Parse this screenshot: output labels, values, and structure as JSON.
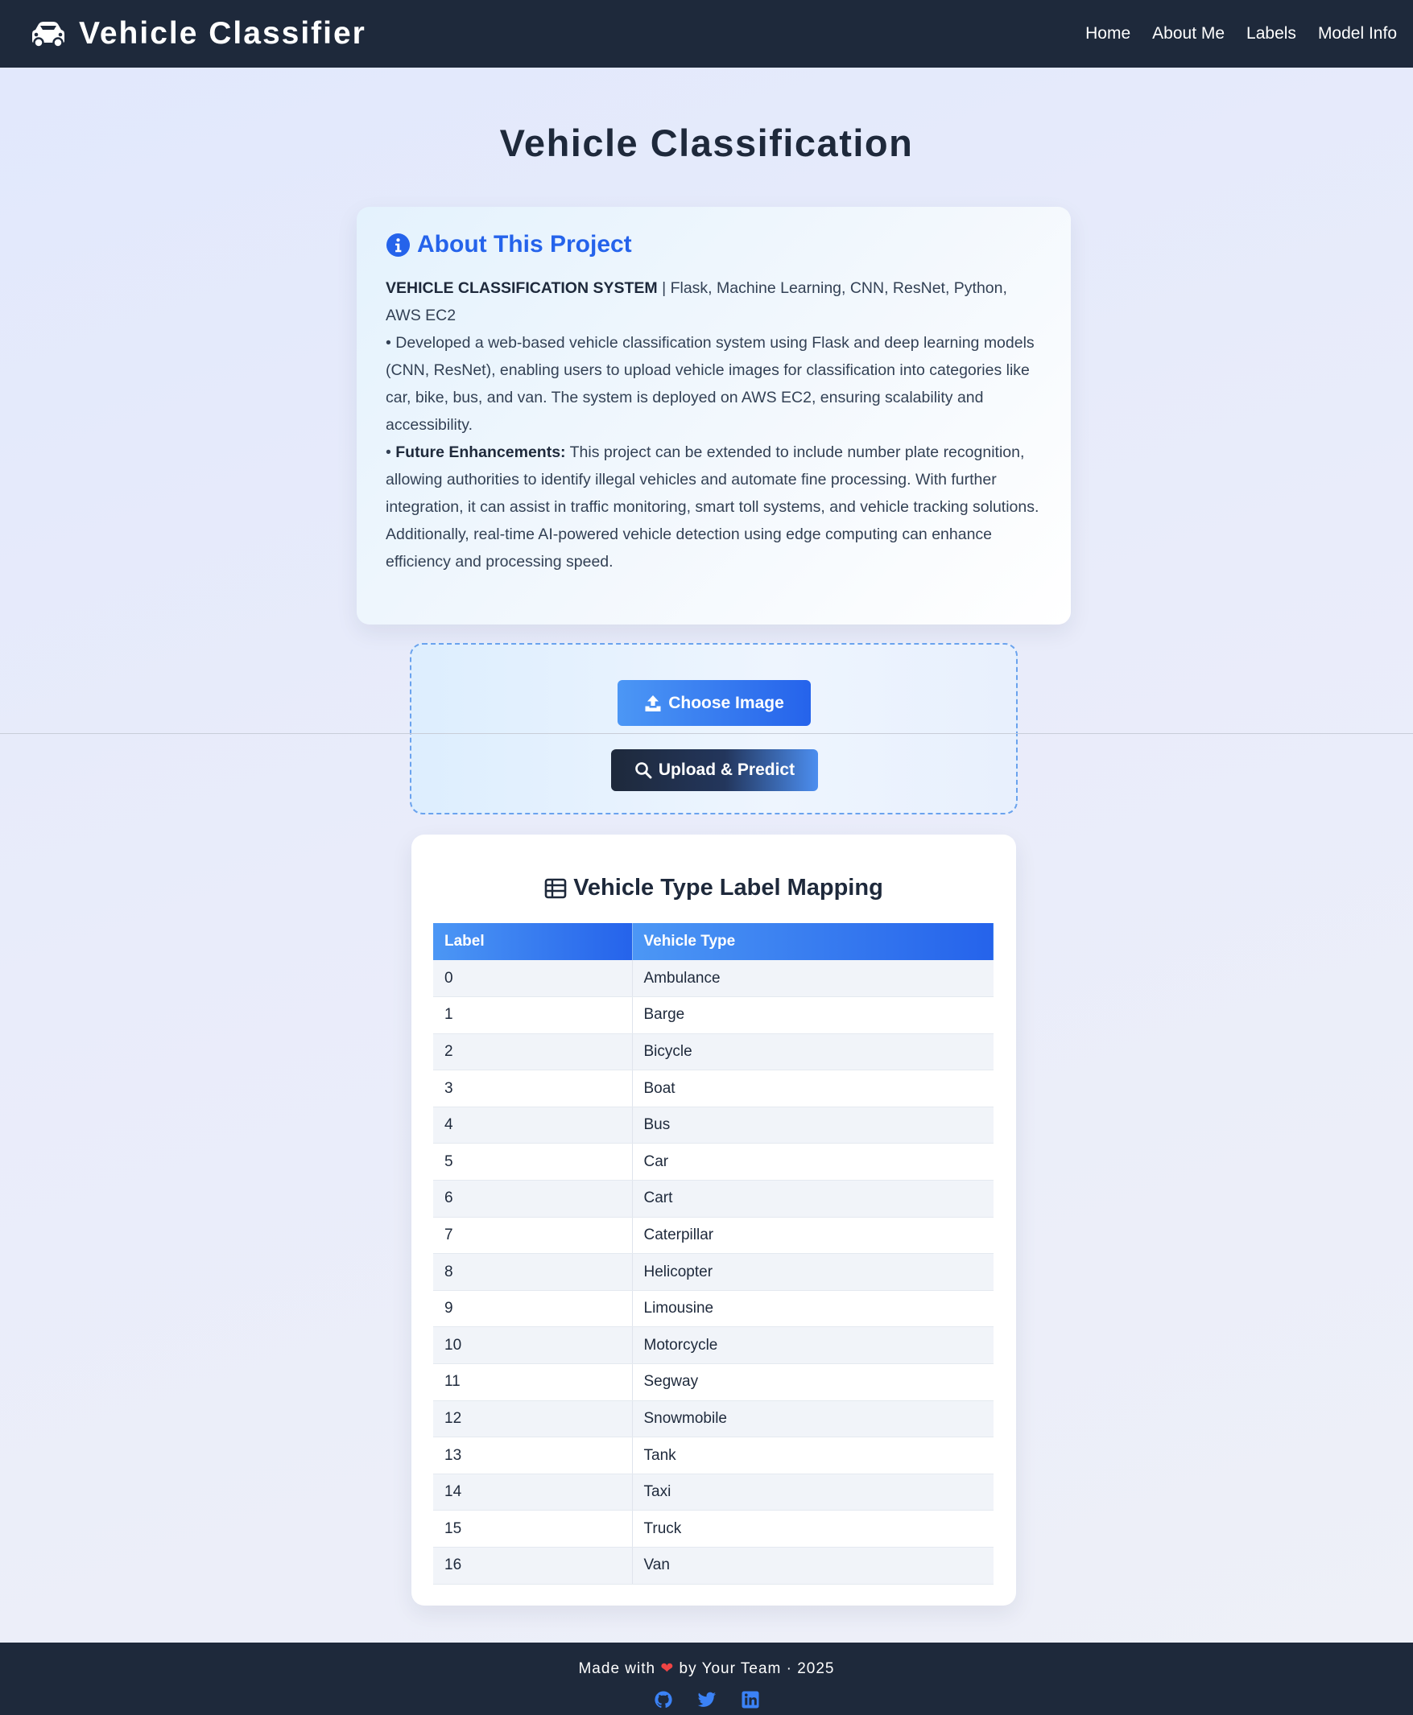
{
  "navbar": {
    "brand_icon": "car-icon",
    "brand": "Vehicle Classifier",
    "links": [
      "Home",
      "About Me",
      "Labels",
      "Model Info"
    ]
  },
  "page_title": "Vehicle Classification",
  "about": {
    "icon": "info-circle-icon",
    "title": "About This Project",
    "system_name": "VEHICLE CLASSIFICATION SYSTEM",
    "tech_stack": " | Flask, Machine Learning, CNN, ResNet, Python, AWS EC2",
    "bullet_1": "• Developed a web-based vehicle classification system using Flask and deep learning models (CNN, ResNet), enabling users to upload vehicle images for classification into categories like car, bike, bus, and van. The system is deployed on AWS EC2, ensuring scalability and accessibility.",
    "bullet_2_prefix": "• ",
    "bullet_2_label": "Future Enhancements:",
    "bullet_2_text": " This project can be extended to include number plate recognition, allowing authorities to identify illegal vehicles and automate fine processing. With further integration, it can assist in traffic monitoring, smart toll systems, and vehicle tracking solutions. Additionally, real-time AI-powered vehicle detection using edge computing can enhance efficiency and processing speed."
  },
  "upload": {
    "choose_label": "Choose Image",
    "choose_icon": "upload-icon",
    "predict_label": "Upload & Predict",
    "predict_icon": "search-icon"
  },
  "label_table": {
    "icon": "table-icon",
    "title": "Vehicle Type Label Mapping",
    "columns": [
      "Label",
      "Vehicle Type"
    ],
    "rows": [
      [
        "0",
        "Ambulance"
      ],
      [
        "1",
        "Barge"
      ],
      [
        "2",
        "Bicycle"
      ],
      [
        "3",
        "Boat"
      ],
      [
        "4",
        "Bus"
      ],
      [
        "5",
        "Car"
      ],
      [
        "6",
        "Cart"
      ],
      [
        "7",
        "Caterpillar"
      ],
      [
        "8",
        "Helicopter"
      ],
      [
        "9",
        "Limousine"
      ],
      [
        "10",
        "Motorcycle"
      ],
      [
        "11",
        "Segway"
      ],
      [
        "12",
        "Snowmobile"
      ],
      [
        "13",
        "Tank"
      ],
      [
        "14",
        "Taxi"
      ],
      [
        "15",
        "Truck"
      ],
      [
        "16",
        "Van"
      ]
    ]
  },
  "footer": {
    "made_with": "Made with ",
    "heart": "❤",
    "by": " by Your Team · 2025",
    "social_icons": [
      "github-icon",
      "twitter-icon",
      "linkedin-icon"
    ]
  },
  "colors": {
    "navbar_bg": "#1e293b",
    "accent_blue": "#2563eb",
    "light_blue": "#4c97f5",
    "heart_red": "#ef4444"
  }
}
